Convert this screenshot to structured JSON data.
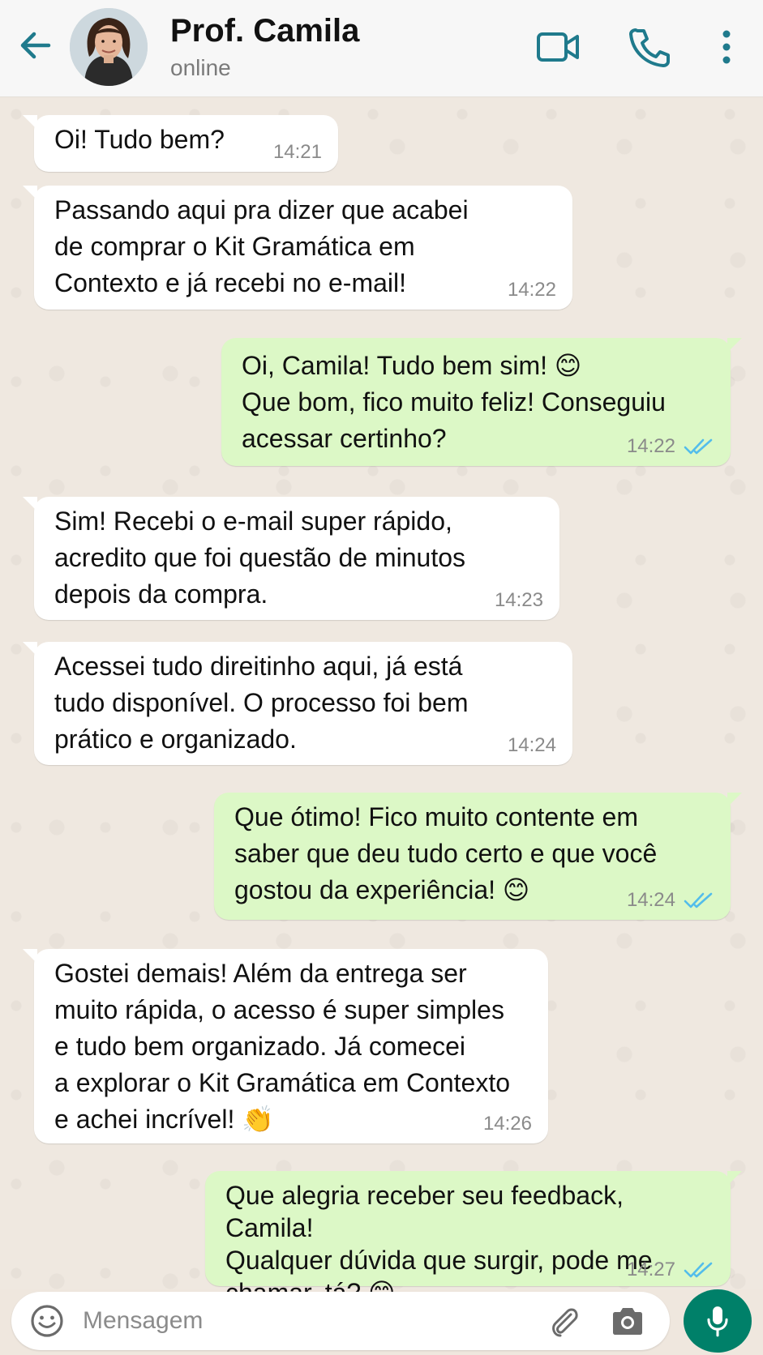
{
  "header": {
    "contact_name": "Prof. Camila",
    "status": "online",
    "accent_color": "#1f7a8c"
  },
  "messages": [
    {
      "direction": "in",
      "text": "Oi! Tudo bem?",
      "time": "14:21"
    },
    {
      "direction": "in",
      "text": "Passando aqui pra dizer que acabei\nde comprar o Kit Gramática em\nContexto e já recebi no e-mail!",
      "time": "14:22"
    },
    {
      "direction": "out",
      "text": "Oi, Camila! Tudo bem sim! 😊\nQue bom, fico muito feliz! Conseguiu\nacessar certinho?",
      "time": "14:22",
      "status": "read"
    },
    {
      "direction": "in",
      "text": "Sim! Recebi o e-mail super rápido,\nacredito que foi questão de minutos\ndepois da compra.",
      "time": "14:23"
    },
    {
      "direction": "in",
      "text": "Acessei tudo direitinho aqui, já está\ntudo disponível. O processo foi bem\nprático e organizado.",
      "time": "14:24"
    },
    {
      "direction": "out",
      "text": "Que ótimo! Fico muito contente em\nsaber que deu tudo certo e que você\ngostou da experiência! 😊",
      "time": "14:24",
      "status": "read"
    },
    {
      "direction": "in",
      "text": "Gostei demais! Além da entrega ser\nmuito rápida, o acesso é super simples\ne tudo bem organizado. Já comecei\na explorar o Kit Gramática em Contexto\ne achei incrível! 👏",
      "time": "14:26"
    },
    {
      "direction": "out",
      "text": "Que alegria receber seu feedback, Camila!\nQualquer dúvida que surgir, pode me\nchamar, tá? 😊",
      "time": "14:27",
      "status": "read"
    }
  ],
  "composer": {
    "placeholder": "Mensagem",
    "send_button_color": "#008069",
    "read_tick_color": "#53bdeb"
  },
  "icons": {
    "back": "arrow-left-icon",
    "video": "video-camera-icon",
    "call": "phone-icon",
    "menu": "more-vertical-icon",
    "emoji": "smiley-icon",
    "attach": "paperclip-icon",
    "camera": "camera-icon",
    "mic": "microphone-icon"
  }
}
